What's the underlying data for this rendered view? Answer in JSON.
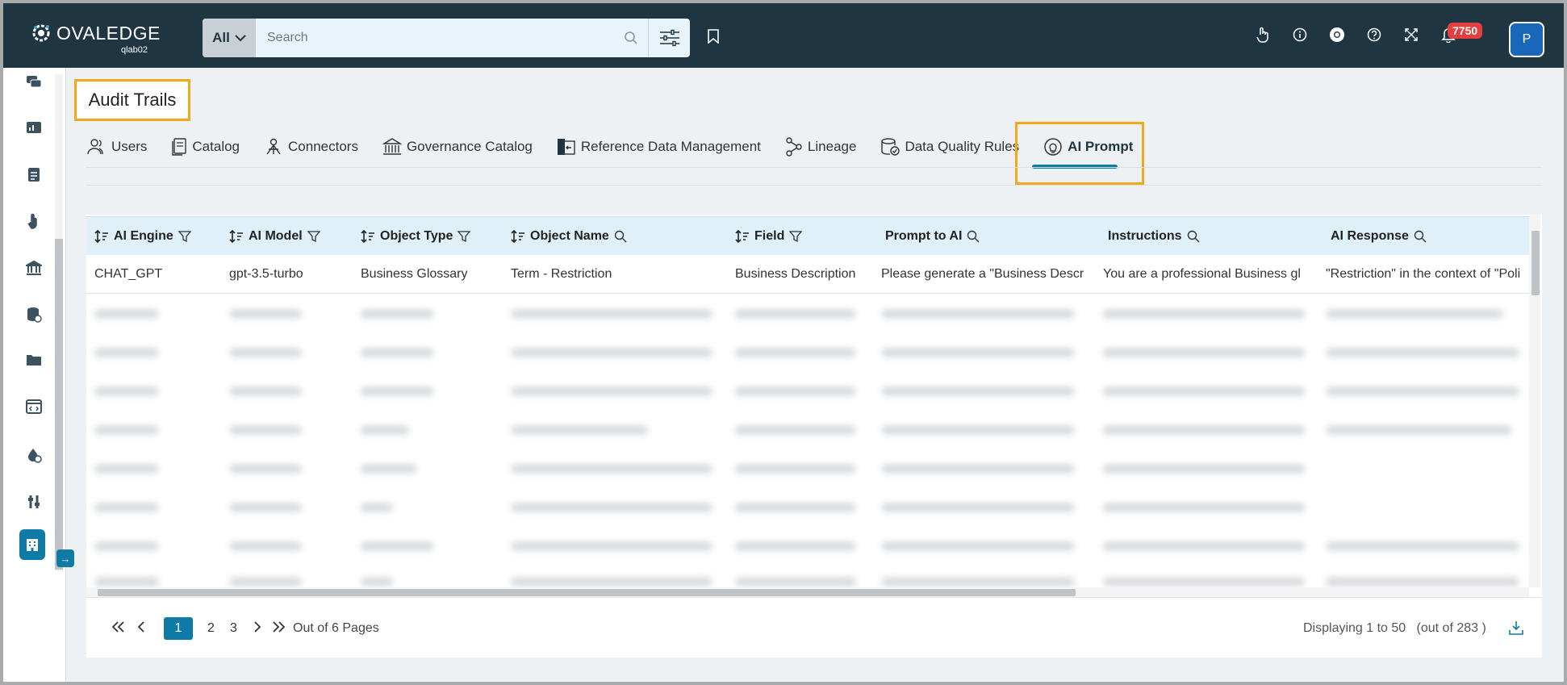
{
  "header": {
    "brand": "OVALEDGE",
    "instance": "qlab02",
    "search_scope": "All",
    "search_placeholder": "Search",
    "notification_count": "7750",
    "avatar_initial": "P"
  },
  "page": {
    "title": "Audit Trails"
  },
  "tabs": [
    {
      "label": "Users",
      "icon": "users-icon"
    },
    {
      "label": "Catalog",
      "icon": "catalog-icon"
    },
    {
      "label": "Connectors",
      "icon": "connectors-icon"
    },
    {
      "label": "Governance Catalog",
      "icon": "bank-icon"
    },
    {
      "label": "Reference Data Management",
      "icon": "reference-data-icon"
    },
    {
      "label": "Lineage",
      "icon": "lineage-icon"
    },
    {
      "label": "Data Quality Rules",
      "icon": "data-quality-icon"
    },
    {
      "label": "AI Prompt",
      "icon": "ai-prompt-icon",
      "active": true
    }
  ],
  "table": {
    "columns": [
      "AI Engine",
      "AI Model",
      "Object Type",
      "Object Name",
      "Field",
      "Prompt to AI",
      "Instructions",
      "AI Response"
    ],
    "first_row": [
      "CHAT_GPT",
      "gpt-3.5-turbo",
      "Business Glossary",
      "Term - Restriction",
      "Business Description",
      "Please generate a \"Business Descr",
      "You are a professional Business gl",
      "\"Restriction\" in the context of \"Poli"
    ]
  },
  "pagination": {
    "current": "1",
    "pages": [
      "2",
      "3"
    ],
    "out_of": "Out of 6 Pages",
    "displaying": "Displaying 1 to 50   (out of 283 )"
  },
  "colors": {
    "topbar": "#1f3541",
    "accent": "#0e7ba6",
    "highlight": "#f2a818",
    "badge": "#e53e3e"
  }
}
